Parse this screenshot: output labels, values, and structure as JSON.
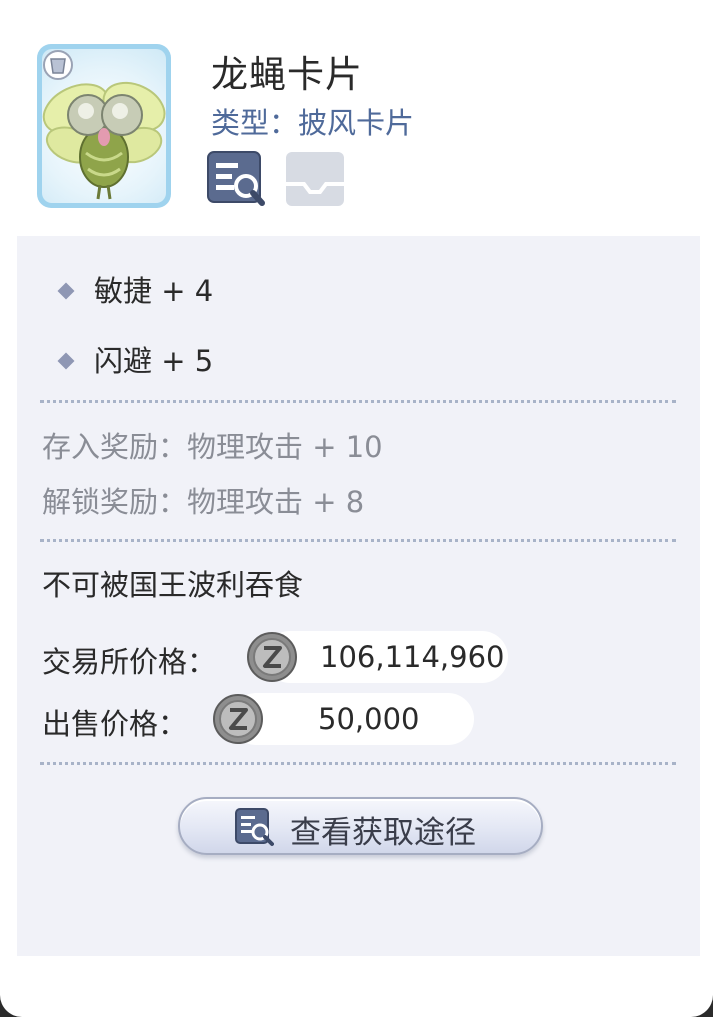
{
  "card": {
    "name": "龙蝇卡片",
    "type_line": "类型：披风卡片",
    "image_icon": "dragonfly-card-art"
  },
  "stats": [
    {
      "label": "敏捷 + 4"
    },
    {
      "label": "闪避 + 5"
    }
  ],
  "bonuses": {
    "deposit": "存入奖励：物理攻击 + 10",
    "unlock": "解锁奖励：物理攻击 + 8"
  },
  "note": "不可被国王波利吞食",
  "prices": {
    "exchange_label": "交易所价格：",
    "exchange_value": "106,114,960",
    "sell_label": "出售价格：",
    "sell_value": "50,000",
    "currency_icon": "zeny-coin-icon"
  },
  "actions": {
    "view_source_label": "查看获取途径",
    "source_icon": "search-document-icon",
    "slot_icon": "tray-icon"
  },
  "colors": {
    "panel_bg": "#ffffff",
    "body_bg": "#f1f2f8",
    "type_text": "#4f6a9a",
    "muted_text": "#8a8d96"
  }
}
